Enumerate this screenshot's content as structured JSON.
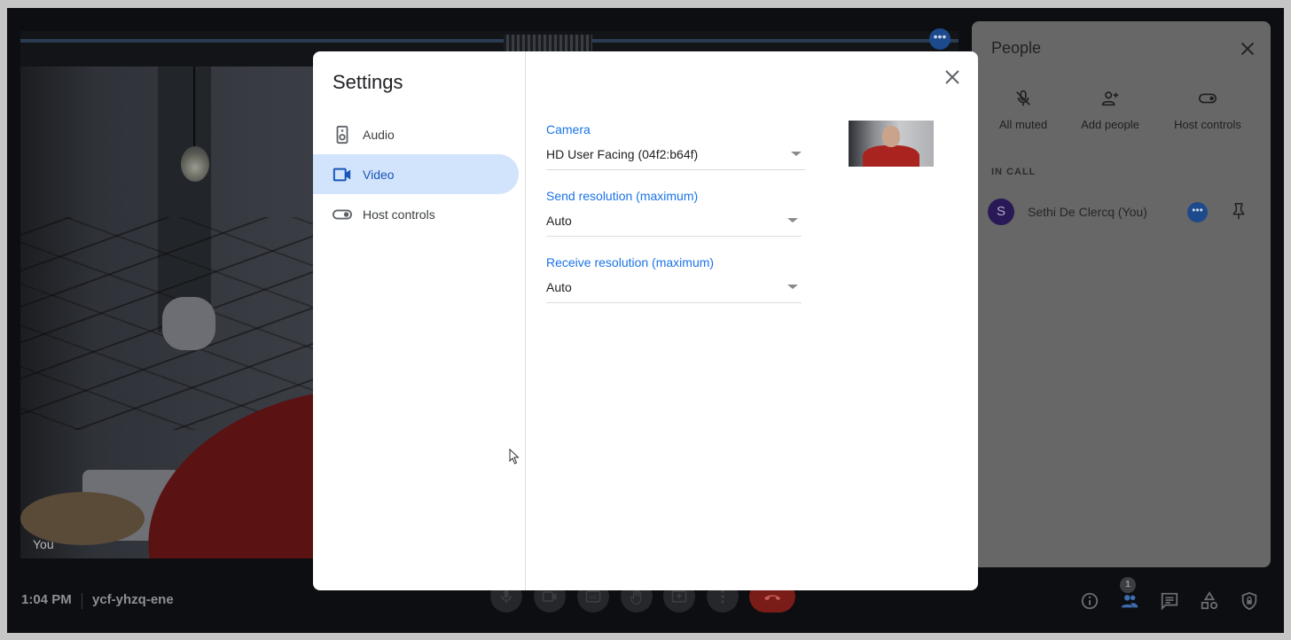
{
  "meeting": {
    "time": "1:04 PM",
    "code": "ycf-yhzq-ene",
    "self_tile_label": "You"
  },
  "controls": {
    "mic": "microphone-icon",
    "camera": "camera-icon",
    "captions": "captions-icon",
    "raise_hand": "hand-icon",
    "present": "present-screen-icon",
    "more": "more-options-icon",
    "hangup": "hang-up-icon"
  },
  "right_controls": {
    "info": "info-icon",
    "people": "people-icon",
    "people_count": "1",
    "chat": "chat-icon",
    "activities": "activities-icon",
    "safety": "host-safety-icon"
  },
  "people_panel": {
    "title": "People",
    "actions": [
      {
        "label": "All muted",
        "icon": "mic-off-icon"
      },
      {
        "label": "Add people",
        "icon": "add-person-icon"
      },
      {
        "label": "Host controls",
        "icon": "toggle-icon"
      }
    ],
    "section_label": "IN CALL",
    "participants": [
      {
        "initial": "S",
        "name": "Sethi De Clercq (You)"
      }
    ]
  },
  "settings": {
    "title": "Settings",
    "nav": [
      {
        "label": "Audio",
        "icon": "speaker-icon",
        "active": false
      },
      {
        "label": "Video",
        "icon": "video-camera-icon",
        "active": true
      },
      {
        "label": "Host controls",
        "icon": "toggle-icon",
        "active": false
      }
    ],
    "fields": [
      {
        "label": "Camera",
        "value": "HD User Facing (04f2:b64f)"
      },
      {
        "label": "Send resolution (maximum)",
        "value": "Auto"
      },
      {
        "label": "Receive resolution (maximum)",
        "value": "Auto"
      }
    ]
  },
  "colors": {
    "accent": "#1a73e8",
    "nav_active_bg": "#d2e3fc",
    "hangup": "#7a1c17",
    "people_active": "#3f6bb0"
  }
}
